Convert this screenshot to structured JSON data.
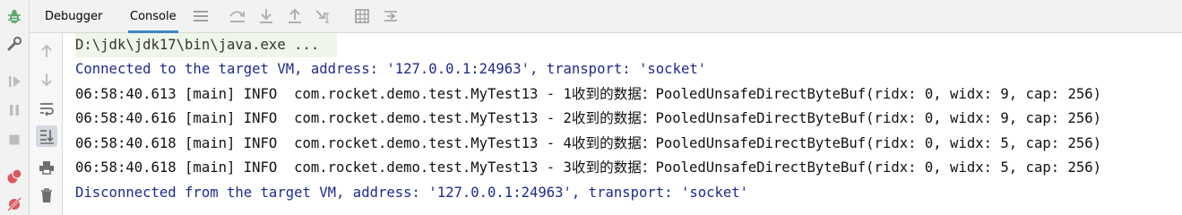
{
  "toolbar": {
    "tabs": [
      {
        "label": "Debugger"
      },
      {
        "label": "Console"
      }
    ],
    "icons": [
      "layout-icon",
      "step-over-icon",
      "step-into-icon",
      "step-out-icon",
      "run-to-cursor-icon",
      "evaluate-icon",
      "trace-icon"
    ]
  },
  "left_strip": {
    "icons": [
      "debug-bug-icon",
      "settings-wrench-icon",
      "resume-icon",
      "pause-icon",
      "stop-icon",
      "view-breakpoints-icon",
      "mute-breakpoints-icon"
    ]
  },
  "console_side": {
    "icons": [
      "scroll-up-icon",
      "scroll-down-icon",
      "soft-wrap-icon",
      "scroll-to-end-icon",
      "print-icon",
      "clear-trash-icon"
    ]
  },
  "console": {
    "lines": [
      "D:\\jdk\\jdk17\\bin\\java.exe ...",
      "Connected to the target VM, address: '127.0.0.1:24963', transport: 'socket'",
      "06:58:40.613 [main] INFO  com.rocket.demo.test.MyTest13 - 1收到的数据：PooledUnsafeDirectByteBuf(ridx: 0, widx: 9, cap: 256)",
      "06:58:40.616 [main] INFO  com.rocket.demo.test.MyTest13 - 2收到的数据：PooledUnsafeDirectByteBuf(ridx: 0, widx: 9, cap: 256)",
      "06:58:40.618 [main] INFO  com.rocket.demo.test.MyTest13 - 4收到的数据：PooledUnsafeDirectByteBuf(ridx: 0, widx: 5, cap: 256)",
      "06:58:40.618 [main] INFO  com.rocket.demo.test.MyTest13 - 3收到的数据：PooledUnsafeDirectByteBuf(ridx: 0, widx: 5, cap: 256)",
      "Disconnected from the target VM, address: '127.0.0.1:24963', transport: 'socket'"
    ]
  },
  "colors": {
    "system_text": "#1d2a8f",
    "log_text": "#111111",
    "command_bg": "#eef6e9",
    "tab_underline": "#4083c9"
  }
}
